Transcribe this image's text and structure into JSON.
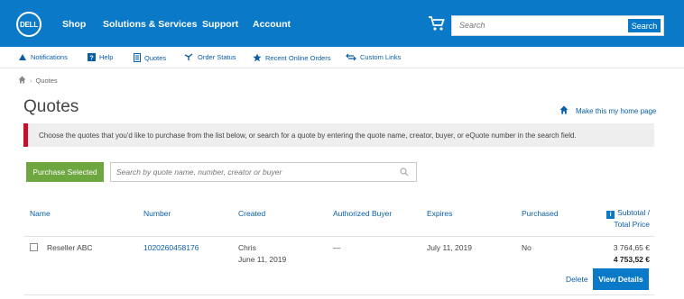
{
  "header": {
    "logo_text": "DELL",
    "nav": [
      "Shop",
      "Solutions & Services",
      "Support",
      "Account"
    ],
    "search_placeholder": "Search",
    "search_button": "Search"
  },
  "subnav": {
    "items": [
      {
        "label": "Notifications",
        "icon": "bell-icon"
      },
      {
        "label": "Help",
        "icon": "help-icon"
      },
      {
        "label": "Quotes",
        "icon": "document-icon"
      },
      {
        "label": "Order Status",
        "icon": "truck-icon"
      },
      {
        "label": "Recent Online Orders",
        "icon": "star-icon"
      },
      {
        "label": "Custom Links",
        "icon": "link-arrows-icon"
      }
    ]
  },
  "breadcrumb": {
    "current": "Quotes"
  },
  "page": {
    "title": "Quotes",
    "home_link": "Make this my home page",
    "notice": "Choose the quotes that you'd like to purchase from the list below, or search for a quote by entering the quote name, creator, buyer, or eQuote number in the search field."
  },
  "actions": {
    "purchase_selected": "Purchase Selected",
    "search_placeholder": "Search by quote name, number, creator or buyer"
  },
  "table": {
    "headers": {
      "name": "Name",
      "number": "Number",
      "created": "Created",
      "authorized_buyer": "Authorized Buyer",
      "expires": "Expires",
      "purchased": "Purchased",
      "subtotal": "Subtotal /",
      "total": "Total Price"
    },
    "rows": [
      {
        "name": "Reseller ABC",
        "number": "1020260458176",
        "created_by": "Chris",
        "created_date": "June 11, 2019",
        "authorized_buyer": "—",
        "expires": "July 11, 2019",
        "purchased": "No",
        "subtotal": "3 764,65 €",
        "total": "4 753,52 €",
        "delete_label": "Delete",
        "view_label": "View Details"
      }
    ]
  },
  "colors": {
    "header_bg": "#0a79c8",
    "link": "#0a5ea8",
    "purchase_button": "#6ea640",
    "notice_accent": "#c8102e"
  }
}
